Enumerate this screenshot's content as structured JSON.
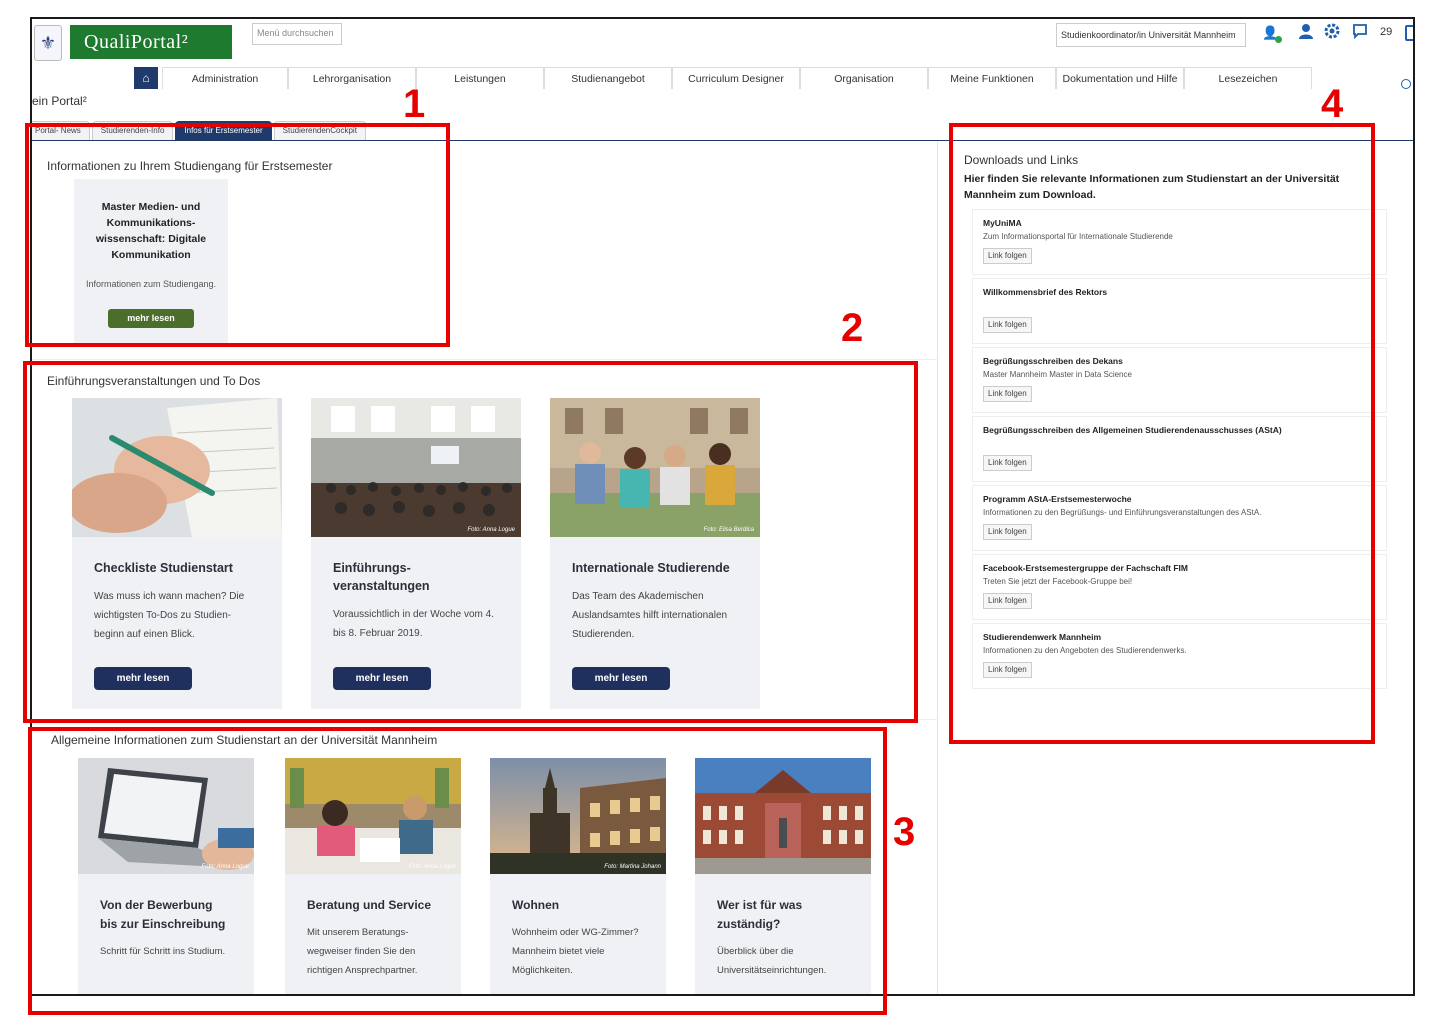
{
  "header": {
    "logo_text": "QualiPortal²",
    "menu_search_placeholder": "Menü durchsuchen",
    "role": "Studienkoordinator/in Universität Mannheim",
    "message_count": "29",
    "portal_title": "ein Portal²"
  },
  "nav": {
    "items": [
      {
        "label": "Administration"
      },
      {
        "label": "Lehrorganisation"
      },
      {
        "label": "Leistungen"
      },
      {
        "label": "Studienangebot"
      },
      {
        "label": "Curriculum Designer"
      },
      {
        "label": "Organisation"
      },
      {
        "label": "Meine Funktionen"
      },
      {
        "label": "Dokumentation und Hilfe"
      },
      {
        "label": "Lesezeichen"
      }
    ]
  },
  "tabs": [
    {
      "label": "Portal- News"
    },
    {
      "label": "Studierenden-Info"
    },
    {
      "label": "Infos für Erstsemester"
    },
    {
      "label": "StudierendenCockpit"
    }
  ],
  "section1": {
    "title": "Informationen zu Ihrem Studiengang für Erstsemester",
    "card": {
      "title": "Master Medien- und Kommunikations-wissenschaft: Digitale Kommunikation",
      "text": "Informationen zum Studiengang.",
      "button": "mehr lesen"
    }
  },
  "section2": {
    "title": "Einführungsveranstaltungen und To Dos",
    "cards": [
      {
        "title": "Checkliste Studienstart",
        "text": "Was muss ich wann machen? Die wichtigsten To-Dos zu Studien-beginn auf einen Blick.",
        "button": "mehr lesen",
        "credit": ""
      },
      {
        "title": "Einführungs-veranstaltungen",
        "text": "Voraussichtlich in der Woche vom 4. bis 8. Februar 2019.",
        "button": "mehr lesen",
        "credit": "Foto: Anna Logue"
      },
      {
        "title": "Internationale Studierende",
        "text": "Das Team des Akademischen Auslandsamtes hilft internationalen Studierenden.",
        "button": "mehr lesen",
        "credit": "Foto: Elisa Berdica"
      }
    ]
  },
  "section3": {
    "title": "Allgemeine Informationen zum Studienstart an der Universität Mannheim",
    "cards": [
      {
        "title": "Von der Bewerbung bis zur Einschreibung",
        "text": "Schritt für Schritt ins Studium.",
        "credit": "Foto: Anna Logue"
      },
      {
        "title": "Beratung und Service",
        "text": "Mit unserem Beratungs-wegweiser finden Sie den richtigen Ansprechpartner.",
        "credit": "Foto: Anna Logue"
      },
      {
        "title": "Wohnen",
        "text": "Wohnheim oder WG-Zimmer? Mannheim bietet viele Möglichkeiten.",
        "credit": "Foto: Martina Johann"
      },
      {
        "title": "Wer ist für was zuständig?",
        "text": "Überblick über die Universitätseinrichtungen.",
        "credit": ""
      }
    ]
  },
  "section4": {
    "title": "Downloads und Links",
    "subtitle": "Hier finden Sie relevante Informationen zum Studienstart an der Universität Mannheim zum Download.",
    "items": [
      {
        "title": "MyUniMA",
        "desc": "Zum Informationsportal für Internationale Studierende",
        "button": "Link folgen"
      },
      {
        "title": "Willkommensbrief des Rektors",
        "desc": "",
        "button": "Link folgen"
      },
      {
        "title": "Begrüßungsschreiben des Dekans",
        "desc": "Master Mannheim Master in Data Science",
        "button": "Link folgen"
      },
      {
        "title": "Begrüßungsschreiben des Allgemeinen Studierendenausschusses (AStA)",
        "desc": "",
        "button": "Link folgen"
      },
      {
        "title": "Programm AStA-Erstsemesterwoche",
        "desc": "Informationen zu den Begrüßungs- und Einführungsveranstaltungen des AStA.",
        "button": "Link folgen"
      },
      {
        "title": "Facebook-Erstsemestergruppe der Fachschaft FIM",
        "desc": "Treten Sie jetzt der Facebook-Gruppe bei!",
        "button": "Link folgen"
      },
      {
        "title": "Studierendenwerk Mannheim",
        "desc": "Informationen zu den Angeboten des Studierendenwerks.",
        "button": "Link folgen"
      }
    ]
  },
  "annotations": [
    "1",
    "2",
    "3",
    "4"
  ],
  "colors": {
    "annotation": "#e60000",
    "navy": "#1f2f5e",
    "green": "#4b6e2a",
    "brand": "#1e7a2e"
  }
}
